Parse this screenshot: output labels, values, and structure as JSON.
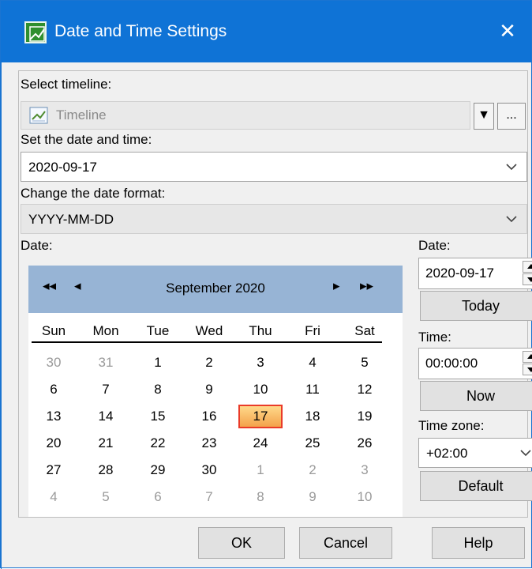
{
  "window": {
    "title": "Date and Time Settings"
  },
  "labels": {
    "select_timeline": "Select timeline:",
    "set_date_time": "Set the date and time:",
    "change_date_format": "Change the date format:",
    "date_left": "Date:",
    "date_right": "Date:",
    "time": "Time:",
    "time_zone": "Time zone:"
  },
  "timeline": {
    "value": "Timeline",
    "more_button": "..."
  },
  "date_time": {
    "value": "2020-09-17"
  },
  "date_format": {
    "value": "YYYY-MM-DD"
  },
  "calendar": {
    "month_year": "September  2020",
    "prev_year": "◂◂",
    "prev_month": "◂",
    "next_month": "▸",
    "next_year": "▸▸",
    "days_of_week": [
      "Sun",
      "Mon",
      "Tue",
      "Wed",
      "Thu",
      "Fri",
      "Sat"
    ],
    "weeks": [
      [
        "30",
        "31",
        "1",
        "2",
        "3",
        "4",
        "5"
      ],
      [
        "6",
        "7",
        "8",
        "9",
        "10",
        "11",
        "12"
      ],
      [
        "13",
        "14",
        "15",
        "16",
        "17",
        "18",
        "19"
      ],
      [
        "20",
        "21",
        "22",
        "23",
        "24",
        "25",
        "26"
      ],
      [
        "27",
        "28",
        "29",
        "30",
        "1",
        "2",
        "3"
      ],
      [
        "4",
        "5",
        "6",
        "7",
        "8",
        "9",
        "10"
      ]
    ],
    "selected_day": "17",
    "header_color": "#97b4d5",
    "selected_border_color": "#ea3b28"
  },
  "right_panel": {
    "date_value": "2020-09-17",
    "today_button": "Today",
    "time_value": "00:00:00",
    "now_button": "Now",
    "time_zone_value": "+02:00",
    "default_button": "Default"
  },
  "footer": {
    "ok_button": "OK",
    "cancel_button": "Cancel",
    "help_button": "Help"
  },
  "colors": {
    "titlebar": "#0f73d6",
    "dialog_background": "#f0f0f0"
  }
}
